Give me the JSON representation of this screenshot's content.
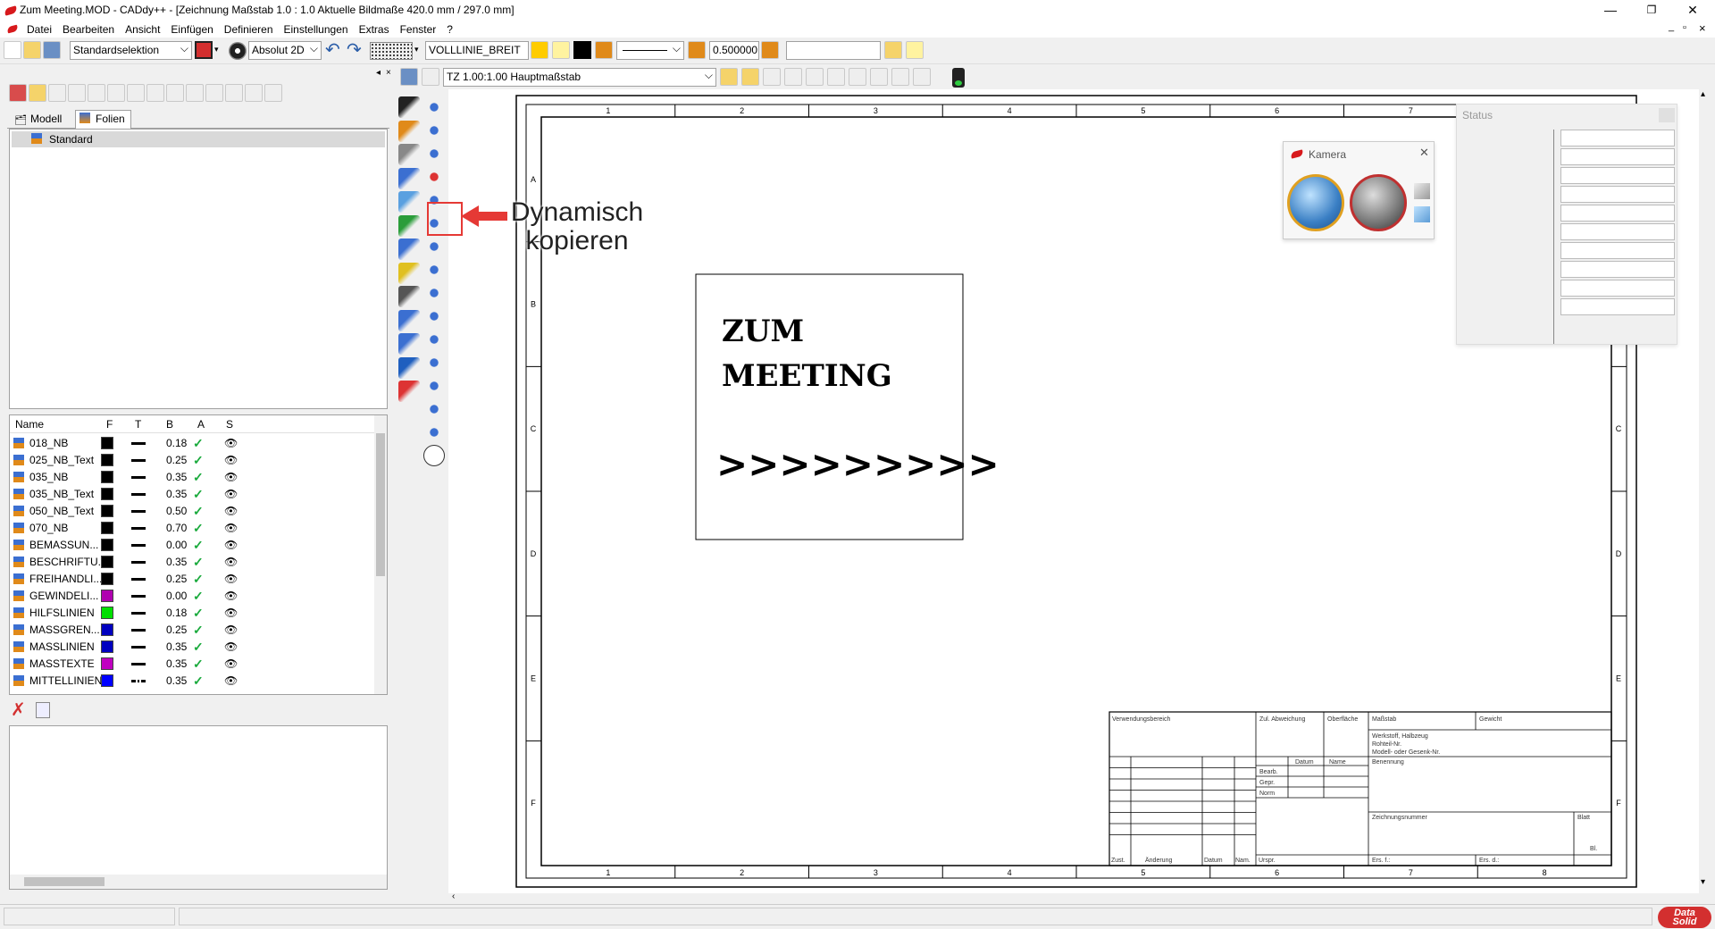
{
  "window": {
    "title": "Zum Meeting.MOD  -  CADdy++ - [Zeichnung   Maßstab 1.0 : 1.0   Aktuelle Bildmaße 420.0 mm / 297.0 mm]",
    "minimize": "—",
    "maximize": "❐",
    "close": "✕",
    "child_minimize": "_",
    "child_maximize": "▫",
    "child_close": "×"
  },
  "menu": [
    "Datei",
    "Bearbeiten",
    "Ansicht",
    "Einfügen",
    "Definieren",
    "Einstellungen",
    "Extras",
    "Fenster",
    "?"
  ],
  "toolbar": {
    "selection_mode": "Standardselektion",
    "coord_mode": "Absolut 2D",
    "line_type": "VOLLLINIE_BREIT",
    "line_width": "0.500000",
    "text_field": ""
  },
  "toolbar2": {
    "scale": "TZ 1.00:1.00 Hauptmaßstab"
  },
  "tabs": {
    "model": "Modell",
    "layers": "Folien"
  },
  "tree": {
    "root": "Standard"
  },
  "layer_table": {
    "headers": [
      "Name",
      "F",
      "T",
      "B",
      "A",
      "S"
    ],
    "rows": [
      {
        "name": "018_NB",
        "color": "#000000",
        "width": "0.18",
        "line": "solid"
      },
      {
        "name": "025_NB_Text",
        "color": "#000000",
        "width": "0.25",
        "line": "solid"
      },
      {
        "name": "035_NB",
        "color": "#000000",
        "width": "0.35",
        "line": "solid"
      },
      {
        "name": "035_NB_Text",
        "color": "#000000",
        "width": "0.35",
        "line": "solid"
      },
      {
        "name": "050_NB_Text",
        "color": "#000000",
        "width": "0.50",
        "line": "solid"
      },
      {
        "name": "070_NB",
        "color": "#000000",
        "width": "0.70",
        "line": "solid"
      },
      {
        "name": "BEMASSUN...",
        "color": "#000000",
        "width": "0.00",
        "line": "solid"
      },
      {
        "name": "BESCHRIFTU...",
        "color": "#000000",
        "width": "0.35",
        "line": "solid"
      },
      {
        "name": "FREIHANDLI...",
        "color": "#000000",
        "width": "0.25",
        "line": "solid"
      },
      {
        "name": "GEWINDELI...",
        "color": "#b000b0",
        "width": "0.00",
        "line": "solid"
      },
      {
        "name": "HILFSLINIEN",
        "color": "#00e000",
        "width": "0.18",
        "line": "solid"
      },
      {
        "name": "MASSGREN...",
        "color": "#0000c0",
        "width": "0.25",
        "line": "solid"
      },
      {
        "name": "MASSLINIEN",
        "color": "#0000c0",
        "width": "0.35",
        "line": "solid"
      },
      {
        "name": "MASSTEXTE",
        "color": "#c000c0",
        "width": "0.35",
        "line": "solid"
      },
      {
        "name": "MITTELLINIEN",
        "color": "#0000ff",
        "width": "0.35",
        "line": "dashdot"
      }
    ],
    "check": "✓",
    "eye": "👁"
  },
  "callout": {
    "line1": "Dynamisch",
    "line2": "kopieren"
  },
  "drawing": {
    "text1": "ZUM",
    "text2": "MEETING",
    "text3": ">>>>>>>>>",
    "col_labels": [
      "1",
      "2",
      "3",
      "4",
      "5",
      "6",
      "7",
      "8"
    ],
    "row_labels": [
      "A",
      "B",
      "C",
      "D",
      "E",
      "F"
    ],
    "title_block": {
      "verwendungsbereich": "Verwendungsbereich",
      "zul_abweichung": "Zul. Abweichung",
      "oberflaeche": "Oberfläche",
      "massstab": "Maßstab",
      "gewicht": "Gewicht",
      "werkstoff": "Werkstoff, Halbzeug",
      "rohteil": "Rohteil-Nr.",
      "modell": "Modell- oder Gesenk-Nr.",
      "datum": "Datum",
      "name": "Name",
      "benennung": "Benennung",
      "bearb": "Bearb.",
      "gepr": "Gepr.",
      "norm": "Norm",
      "zeichnungsnummer": "Zeichnungsnummer",
      "blatt": "Blatt",
      "bl": "Bl.",
      "zust": "Zust.",
      "aenderung": "Änderung",
      "datum2": "Datum",
      "nam": "Nam.",
      "urspr": "Urspr.",
      "ers_f": "Ers. f.:",
      "ers_d": "Ers. d.:"
    }
  },
  "kamera": {
    "title": "Kamera",
    "close": "✕"
  },
  "status_panel": {
    "title": "Status"
  },
  "brand": {
    "l1": "Data",
    "l2": "Solid"
  },
  "colors": {
    "accent_red": "#e53935",
    "callout_red": "#e53935"
  }
}
